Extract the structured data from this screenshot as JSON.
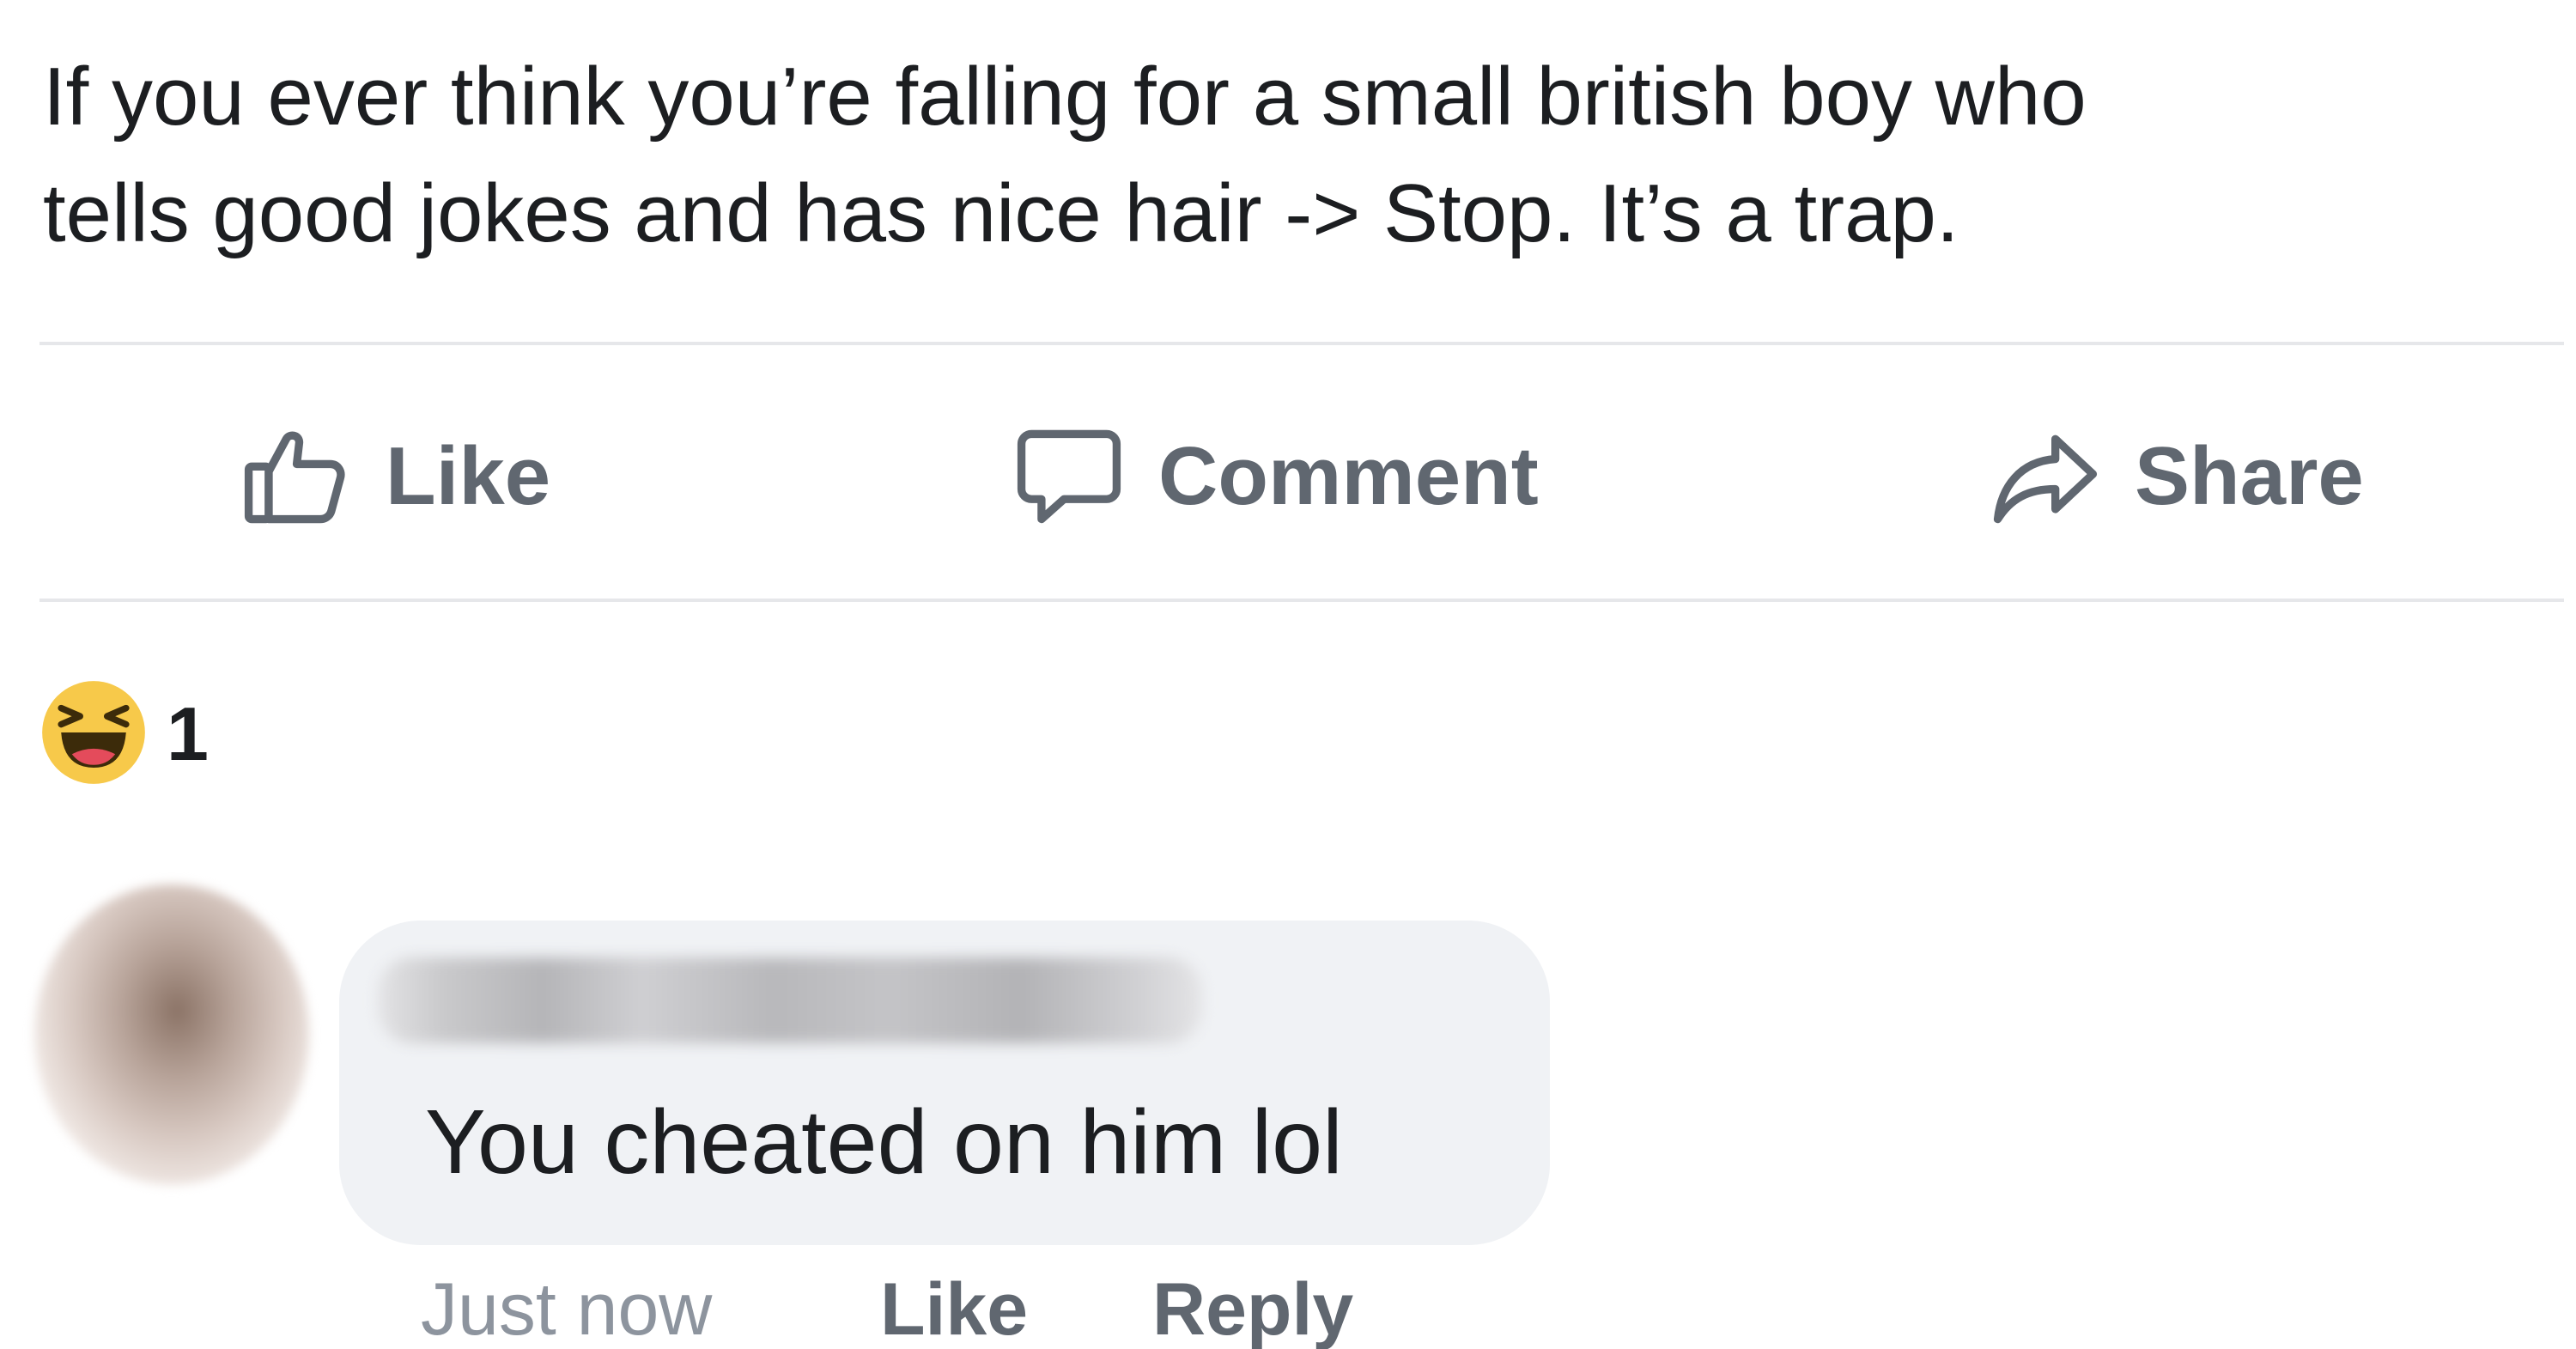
{
  "post": {
    "text": "If you ever think you’re falling for a small british boy who\ntells good jokes and has nice hair -> Stop. It’s a trap."
  },
  "actions": {
    "like_label": "Like",
    "comment_label": "Comment",
    "share_label": "Share"
  },
  "reactions": {
    "icon": "haha-emoji-icon",
    "count": "1"
  },
  "comment": {
    "text": "You cheated on him lol",
    "timestamp": "Just now",
    "like_label": "Like",
    "reply_label": "Reply"
  },
  "colors": {
    "text": "#1c1e21",
    "action_gray": "#606770",
    "meta_gray": "#8d949e",
    "bubble_bg": "#f0f2f5",
    "divider": "#e6e7ea",
    "emoji_yellow": "#f7c94a"
  }
}
